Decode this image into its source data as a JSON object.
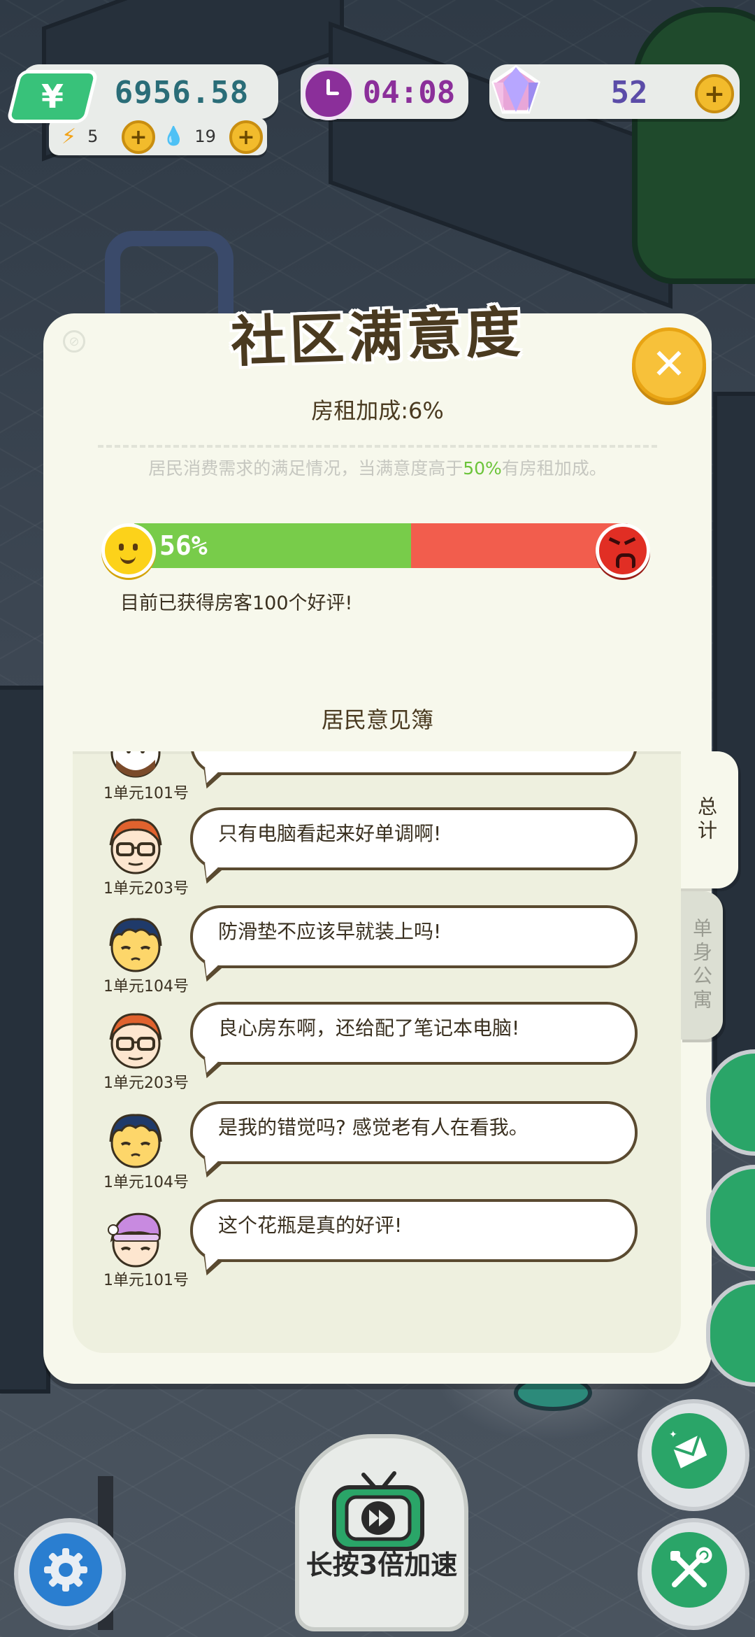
{
  "hud": {
    "money": "6956.58",
    "money_icon": "yuan-icon",
    "energy": "5",
    "water": "19",
    "time": "04:08",
    "gems": "52"
  },
  "modal": {
    "title": "社区满意度",
    "rent_bonus": "房租加成:6%",
    "desc_before": "居民消费需求的满足情况，当满意度高于",
    "desc_pct": "50%",
    "desc_after": "有房租加成。",
    "satisfaction_value": 56,
    "satisfaction_label": "56%",
    "good_reviews": "目前已获得房客100个好评!",
    "opinion_title": "居民意见簿",
    "colors": {
      "good": "#78cc4a",
      "bad": "#f25d4d",
      "accent": "#6cc43a"
    }
  },
  "tabs": {
    "total": "总计",
    "single": "单身公寓"
  },
  "comments": [
    {
      "room": "1单元101号",
      "text": "",
      "rating": "up",
      "avatar": "bearded-resident-avatar"
    },
    {
      "room": "1单元203号",
      "text": "只有电脑看起来好单调啊!",
      "rating": "down",
      "avatar": "glasses-resident-avatar"
    },
    {
      "room": "1单元104号",
      "text": "防滑垫不应该早就装上吗!",
      "rating": "down",
      "avatar": "sleepy-resident-avatar"
    },
    {
      "room": "1单元203号",
      "text": "良心房东啊，还给配了笔记本电脑!",
      "rating": "up",
      "avatar": "glasses-resident-avatar"
    },
    {
      "room": "1单元104号",
      "text": "是我的错觉吗? 感觉老有人在看我。",
      "rating": "down",
      "avatar": "sleepy-resident-avatar"
    },
    {
      "room": "1单元101号",
      "text": "这个花瓶是真的好评!",
      "rating": "up",
      "avatar": "nightcap-resident-avatar"
    }
  ],
  "controls": {
    "speed_label": "长按3倍加速"
  }
}
